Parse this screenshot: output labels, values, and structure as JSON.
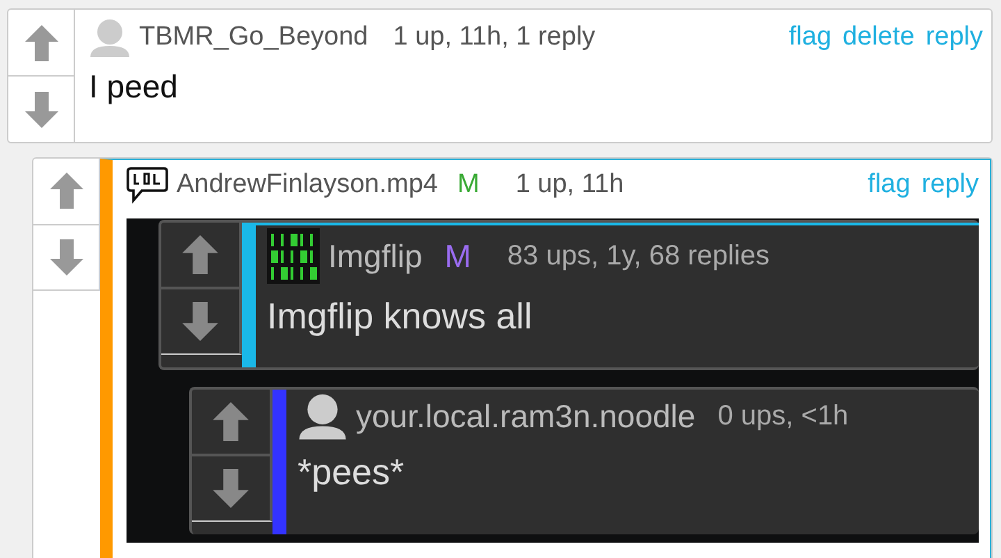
{
  "comments": [
    {
      "username": "TBMR_Go_Beyond",
      "avatar": {
        "kind": "silhouette"
      },
      "meta": "1 up, 11h, 1 reply",
      "actions": [
        "flag",
        "delete",
        "reply"
      ],
      "text": "I peed",
      "children": [
        {
          "username": "AndrewFinlayson.mp4",
          "avatar": {
            "kind": "lol"
          },
          "badge": {
            "text": "M",
            "color": "#3aaa35"
          },
          "color": "#ff9900",
          "meta": "1 up, 11h",
          "actions": [
            "flag",
            "reply"
          ],
          "image": {
            "kind": "screenshot",
            "comments": [
              {
                "username": "Imgflip",
                "avatar": {
                  "kind": "binary"
                },
                "badge": {
                  "text": "M",
                  "color": "#9a6cf0"
                },
                "color": "#1ab8e8",
                "meta": "83 ups, 1y, 68 replies",
                "text": "Imgflip knows all",
                "children": [
                  {
                    "username": "your.local.ram3n.noodle",
                    "avatar": {
                      "kind": "silhouette"
                    },
                    "color": "#3333ff",
                    "meta": "0 ups, <1h",
                    "text": "*pees*"
                  }
                ]
              }
            ]
          }
        }
      ]
    }
  ]
}
